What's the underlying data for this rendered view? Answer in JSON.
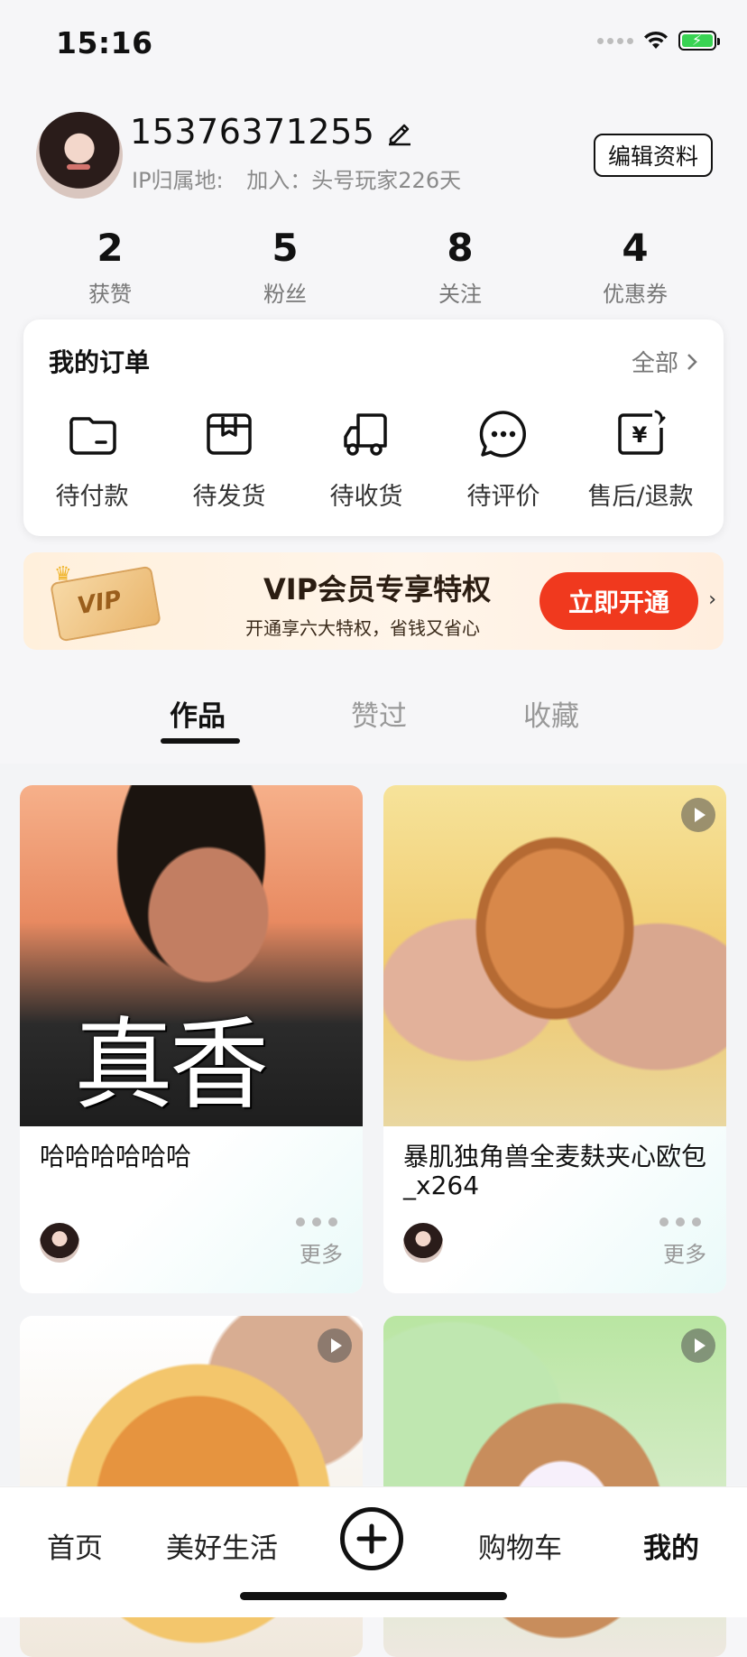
{
  "status_bar": {
    "time": "15:16",
    "icons": [
      "cellular-dots-icon",
      "wifi-icon",
      "battery-charging-icon"
    ]
  },
  "profile": {
    "phone": "15376371255",
    "ip_label": "IP归属地:",
    "join_text": "加入：头号玩家226天",
    "edit_button": "编辑资料"
  },
  "stats": [
    {
      "value": "2",
      "label": "获赞"
    },
    {
      "value": "5",
      "label": "粉丝"
    },
    {
      "value": "8",
      "label": "关注"
    },
    {
      "value": "4",
      "label": "优惠券"
    }
  ],
  "orders": {
    "title": "我的订单",
    "all_label": "全部",
    "items": [
      {
        "label": "待付款",
        "icon": "wallet-icon"
      },
      {
        "label": "待发货",
        "icon": "package-icon"
      },
      {
        "label": "待收货",
        "icon": "delivery-truck-icon"
      },
      {
        "label": "待评价",
        "icon": "chat-bubble-icon"
      },
      {
        "label": "售后/退款",
        "icon": "refund-icon"
      }
    ]
  },
  "vip": {
    "card_text": "VIP",
    "title": "VIP会员专享特权",
    "subtitle": "开通享六大特权，省钱又省心",
    "button": "立即开通"
  },
  "tabs": [
    {
      "label": "作品",
      "active": true
    },
    {
      "label": "赞过",
      "active": false
    },
    {
      "label": "收藏",
      "active": false
    }
  ],
  "posts": [
    {
      "title": "哈哈哈哈哈哈",
      "image_overlay_text": "真香",
      "more": "更多",
      "has_play": false
    },
    {
      "title": "暴肌独角兽全麦麸夹心欧包_x264",
      "more": "更多",
      "has_play": true
    },
    {
      "title": "",
      "more": "",
      "has_play": true
    },
    {
      "title": "",
      "more": "",
      "has_play": true
    }
  ],
  "bottom_nav": [
    {
      "label": "首页"
    },
    {
      "label": "美好生活"
    },
    {
      "label": "购物车"
    },
    {
      "label": "我的",
      "active": true
    }
  ],
  "colors": {
    "vip_button": "#f0391e",
    "accent_text": "#111111",
    "muted": "#999999"
  }
}
